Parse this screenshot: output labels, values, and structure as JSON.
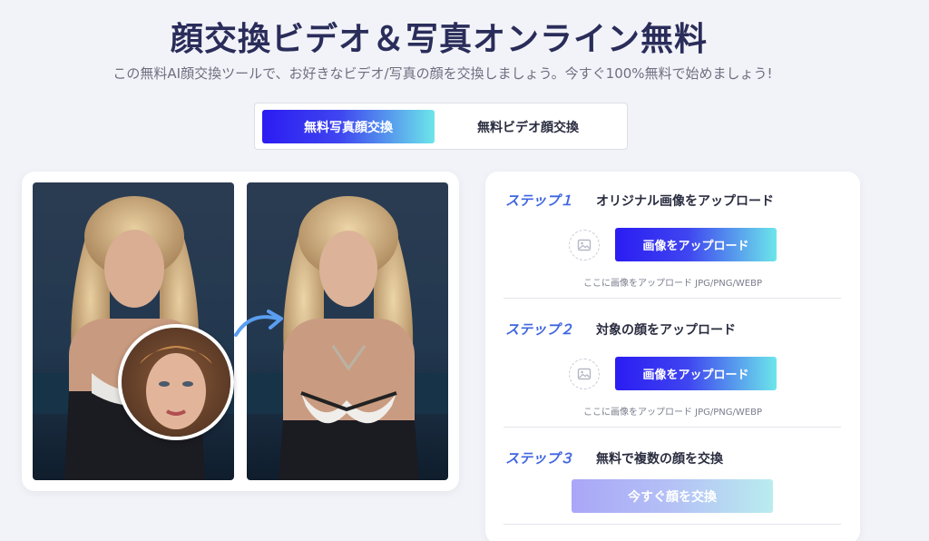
{
  "header": {
    "title": "顔交換ビデオ＆写真オンライン無料",
    "subtitle": "この無料AI顔交換ツールで、お好きなビデオ/写真の顔を交換しましょう。今すぐ100%無料で始めましょう!"
  },
  "tabs": [
    {
      "label": "無料写真顔交換",
      "active": true
    },
    {
      "label": "無料ビデオ顔交換",
      "active": false
    }
  ],
  "steps": [
    {
      "number": "ステップ１",
      "title": "オリジナル画像をアップロード",
      "button": "画像をアップロード",
      "hint": "ここに画像をアップロード JPG/PNG/WEBP"
    },
    {
      "number": "ステップ２",
      "title": "対象の顔をアップロード",
      "button": "画像をアップロード",
      "hint": "ここに画像をアップロード JPG/PNG/WEBP"
    },
    {
      "number": "ステップ３",
      "title": "無料で複数の顔を交換",
      "button": "今すぐ顔を交換"
    }
  ],
  "colors": {
    "accent_start": "#2b1cf2",
    "accent_end": "#6ce6ea",
    "step_label": "#3f66e0",
    "title": "#2a2d5a"
  },
  "icons": {
    "image_placeholder": "image-icon",
    "arrow": "curved-arrow-icon"
  }
}
